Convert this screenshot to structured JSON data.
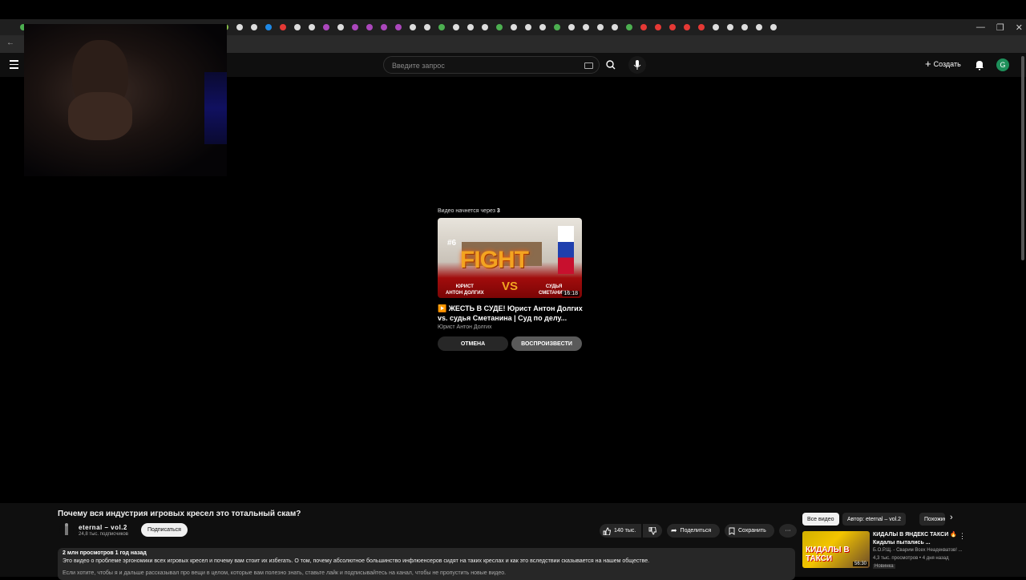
{
  "search": {
    "placeholder": "Введите запрос"
  },
  "header": {
    "create_label": "Создать",
    "avatar_letter": "G"
  },
  "endscreen": {
    "starts_label": "Видео начнется через",
    "countdown": "3",
    "thumb": {
      "number": "#6",
      "word": "FIGHT",
      "vs": "VS",
      "left_label_1": "ЮРИСТ",
      "left_label_2": "АНТОН ДОЛГИХ",
      "right_label_1": "СУДЬЯ",
      "right_label_2": "СМЕТАНИНА"
    },
    "duration": "16:18",
    "title": "▶️ ЖЕСТЬ В СУДЕ! Юрист Антон Долгих vs. судья Сметанина | Суд по делу...",
    "channel": "Юрист Антон Долгих",
    "cancel_label": "ОТМЕНА",
    "play_label": "ВОСПРОИЗВЕСТИ"
  },
  "video": {
    "title": "Почему вся индустрия игровых кресел это тотальный скам?",
    "channel_name": "eternal – vol.2",
    "subscribers": "24,8 тыс. подписчиков",
    "subscribe_label": "Подписаться",
    "likes": "140 тыс.",
    "share_label": "Поделиться",
    "save_label": "Сохранить",
    "more_label": "···",
    "meta": "2 млн просмотров  1 год назад",
    "description": "Это видео о проблеме эргономики всех игровых кресел и почему вам стоит их избегать. О том, почему абсолютное большинство инфлюенсеров сидят на таких креслах и как это вследствии сказывается на нашем обществе.",
    "description_more": "Если хотите, чтобы я и дальше рассказывал про вещи в целом, которые вам полезно знать, ставьте лайк и подписывайтесь на канал, чтобы не пропустить новые видео."
  },
  "chips": {
    "all": "Все видео",
    "author": "Автор: eternal – vol.2",
    "similar": "Похожие"
  },
  "recommendation": {
    "thumb_text": "КИДАЛЫ В ТАКСИ",
    "duration": "56:30",
    "title": "КИДАЛЫ В ЯНДЕКС ТАКСИ 🔥 Кидалы пытались ...",
    "channel": "Б.О.Р.Щ. - Сварим Всех Неадекватов! ...",
    "views": "4,3 тыс. просмотров • 4 дня назад",
    "badge": "Новинка"
  },
  "colors": {
    "accent": "#3ea6ff",
    "background": "#0f0f0f",
    "avatar": "#1e8f5a"
  }
}
